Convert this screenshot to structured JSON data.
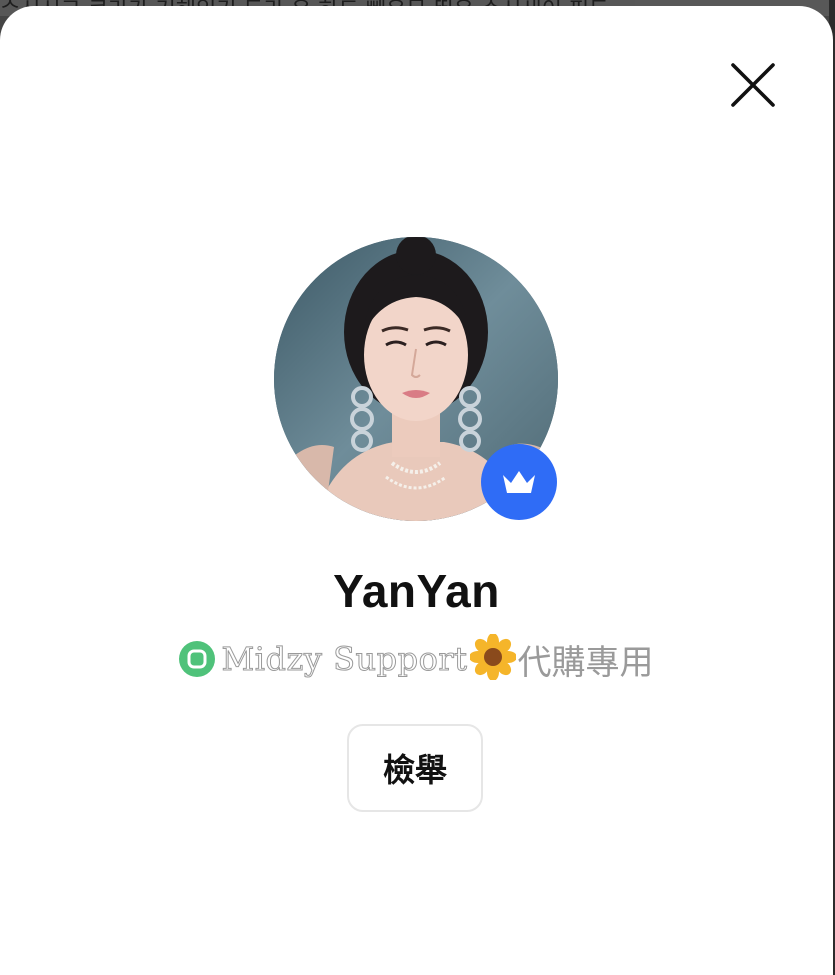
{
  "background": {
    "top_text": "ᄉ시시그 ᄏ라가 거해있기 ᄃ라 ᄋ 하드 빼우뮤 뛰우 ᄉ시새이 피ᄃ"
  },
  "modal": {
    "close_icon": "close-icon",
    "avatar_icon": "profile-photo",
    "badge_icon": "crown-icon",
    "badge_color": "#2f6cf6",
    "username": "YanYan",
    "bio": {
      "prefix_icon": "green-circle-icon",
      "text": "Midzy Support",
      "emoji": "sunflower",
      "suffix": "代購專用"
    },
    "report_button_label": "檢舉"
  }
}
